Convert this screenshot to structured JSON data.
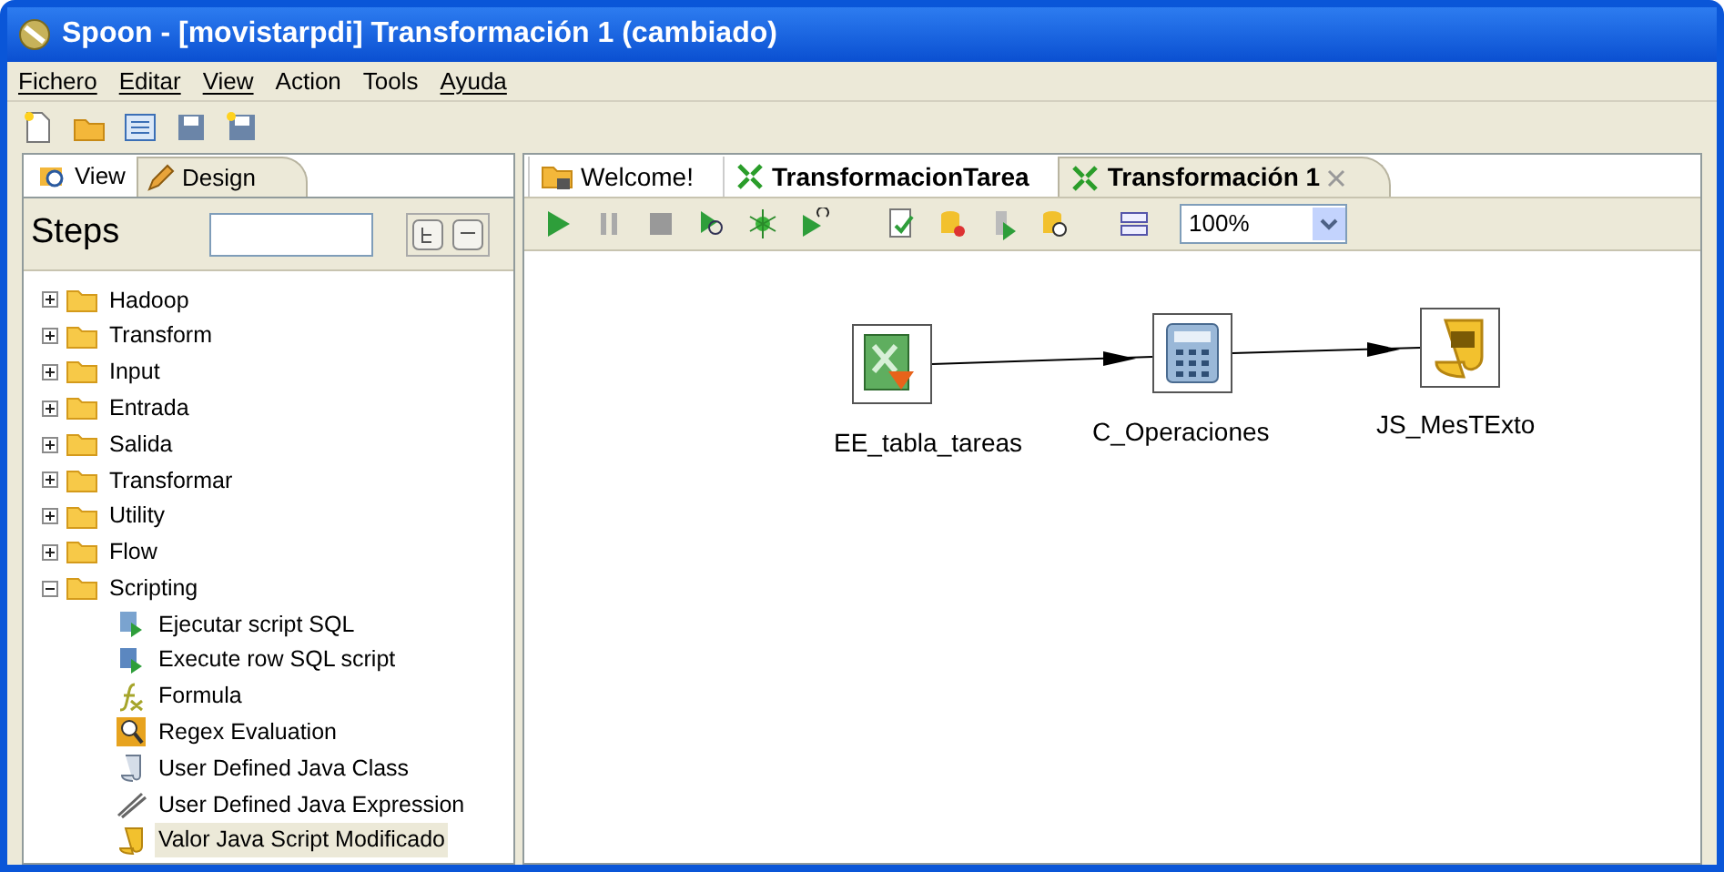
{
  "window": {
    "title": "Spoon - [movistarpdi] Transformación 1 (cambiado)"
  },
  "menu": [
    {
      "label": "Fichero",
      "mnemonic": true
    },
    {
      "label": "Editar",
      "mnemonic": true
    },
    {
      "label": "View",
      "mnemonic": true
    },
    {
      "label": "Action",
      "mnemonic": false
    },
    {
      "label": "Tools",
      "mnemonic": false
    },
    {
      "label": "Ayuda",
      "mnemonic": true
    }
  ],
  "left_tabs": [
    {
      "label": "View",
      "selected": false
    },
    {
      "label": "Design",
      "selected": true
    }
  ],
  "steps": {
    "label": "Steps"
  },
  "tree": [
    {
      "label": "Hadoop",
      "expanded": false
    },
    {
      "label": "Transform",
      "expanded": false
    },
    {
      "label": "Input",
      "expanded": false
    },
    {
      "label": "Entrada",
      "expanded": false
    },
    {
      "label": "Salida",
      "expanded": false
    },
    {
      "label": "Transformar",
      "expanded": false
    },
    {
      "label": "Utility",
      "expanded": false
    },
    {
      "label": "Flow",
      "expanded": false
    },
    {
      "label": "Scripting",
      "expanded": true,
      "children": [
        {
          "label": "Ejecutar script SQL",
          "kind": "sql",
          "selected": false
        },
        {
          "label": "Execute row SQL script",
          "kind": "sqlrow",
          "selected": false
        },
        {
          "label": "Formula",
          "kind": "formula",
          "selected": false
        },
        {
          "label": "Regex Evaluation",
          "kind": "regex",
          "selected": false
        },
        {
          "label": "User Defined Java Class",
          "kind": "javaclass",
          "selected": false
        },
        {
          "label": "User Defined Java Expression",
          "kind": "javaexpr",
          "selected": false
        },
        {
          "label": "Valor Java Script Modificado",
          "kind": "js",
          "selected": true
        }
      ]
    }
  ],
  "editor_tabs": [
    {
      "label": "Welcome!",
      "kind": "welcome",
      "selected": false,
      "closable": false
    },
    {
      "label": "TransformacionTarea",
      "kind": "transformation",
      "selected": false,
      "closable": false
    },
    {
      "label": "Transformación 1",
      "kind": "transformation",
      "selected": true,
      "closable": true
    }
  ],
  "zoom": {
    "value": "100%"
  },
  "canvas": {
    "nodes": [
      {
        "label": "EE_tabla_tareas",
        "kind": "excel"
      },
      {
        "label": "C_Operaciones",
        "kind": "calculator"
      },
      {
        "label": "JS_MesTExto",
        "kind": "js"
      }
    ]
  }
}
